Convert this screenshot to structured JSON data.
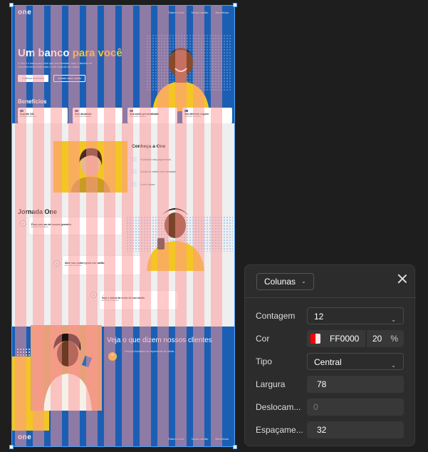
{
  "design": {
    "logo": "one",
    "nav_links": [
      "Sobre a One",
      "Nosso cartão",
      "Benefícios"
    ],
    "hero": {
      "title_main": "Um banco",
      "title_accent": "para você",
      "subtitle": "O One é o banco para você que ama liberdade. Aqui, o dinheiro na sua conta rende muito mais e você cuida do seu salário.",
      "primary_button": "Conheça benefícios",
      "secondary_button": "Assinar nosso cartão"
    },
    "benefits_title": "Benefícios",
    "benefits": [
      {
        "title": "Suporte 24h",
        "desc": "Exemplo ilustrativo"
      },
      {
        "title": "Sem anuidade",
        "desc": "Exemplo ilustrativo"
      },
      {
        "title": "Sua conta personalizada",
        "desc": "Exemplo ilustrativo"
      },
      {
        "title": "Seu dinheiro seguro",
        "desc": "Exemplo ilustrativo"
      }
    ],
    "meet": {
      "title": "Conheça a One",
      "items": [
        "Facilidade nos pagamentos",
        "Cartão de crédito sem anuidade",
        "Lorem Ipsum"
      ]
    },
    "journey": {
      "title": "Jornada One",
      "steps": [
        {
          "num": "1",
          "title": "Faça com um de nossos gerentes",
          "desc": "Exemplo ilustrativo"
        },
        {
          "num": "2",
          "title": "Abra sua conta e peça seu cartão",
          "desc": "Exemplo ilustrativo"
        },
        {
          "num": "3",
          "title": "Veja o status de envio do seu cartão",
          "desc": "Exemplo ilustrativo"
        }
      ]
    },
    "testimonials": {
      "title": "Veja o que dizem nossos clientes",
      "quote_icon": "❝",
      "text": "Exemplo ilustrativo de depoimento de cliente."
    },
    "footer_links": [
      "Sobre a One",
      "Nosso cartão",
      "Benefícios"
    ]
  },
  "grid_panel": {
    "layout_type": "Colunas",
    "count_label": "Contagem",
    "count_value": "12",
    "color_label": "Cor",
    "color_hex": "FF0000",
    "color_opacity": "20",
    "percent_symbol": "%",
    "type_label": "Tipo",
    "type_value": "Central",
    "width_label": "Largura",
    "width_value": "78",
    "offset_label": "Deslocam...",
    "offset_value": "0",
    "gutter_label": "Espaçame...",
    "gutter_value": "32",
    "colors": {
      "grid_color": "#FF0000",
      "panel_bg": "#2c2c2c",
      "brand_blue": "#1a5fb4",
      "accent_yellow": "#f3c623"
    }
  }
}
